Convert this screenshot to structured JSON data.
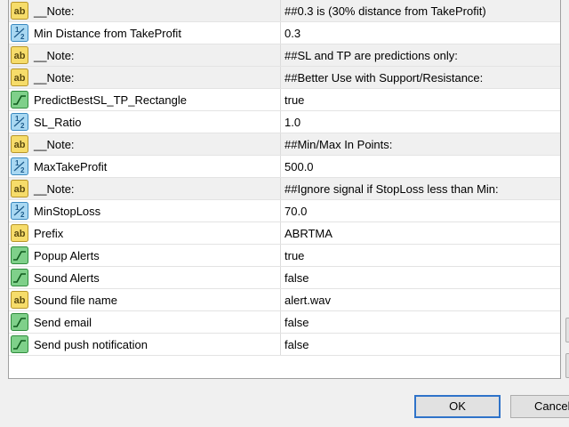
{
  "params": [
    {
      "type": "ab",
      "name": "__Note:",
      "value": "##0.3 is (30% distance from TakeProfit)",
      "icon": "string-icon"
    },
    {
      "type": "half",
      "name": "Min Distance from TakeProfit",
      "value": "0.3",
      "icon": "double-icon"
    },
    {
      "type": "ab",
      "name": "__Note:",
      "value": "##SL and TP are predictions only:",
      "icon": "string-icon"
    },
    {
      "type": "ab",
      "name": "__Note:",
      "value": "##Better Use with Support/Resistance:",
      "icon": "string-icon"
    },
    {
      "type": "bool",
      "name": "PredictBestSL_TP_Rectangle",
      "value": "true",
      "icon": "bool-icon"
    },
    {
      "type": "half",
      "name": "SL_Ratio",
      "value": "1.0",
      "icon": "double-icon"
    },
    {
      "type": "ab",
      "name": "__Note:",
      "value": "##Min/Max In Points:",
      "icon": "string-icon"
    },
    {
      "type": "half",
      "name": "MaxTakeProfit",
      "value": "500.0",
      "icon": "double-icon"
    },
    {
      "type": "ab",
      "name": "__Note:",
      "value": "##Ignore signal if StopLoss less than Min:",
      "icon": "string-icon"
    },
    {
      "type": "half",
      "name": "MinStopLoss",
      "value": "70.0",
      "icon": "double-icon"
    },
    {
      "type": "ab",
      "name": "Prefix",
      "value": "ABRTMA",
      "icon": "string-icon"
    },
    {
      "type": "bool",
      "name": "Popup Alerts",
      "value": "true",
      "icon": "bool-icon"
    },
    {
      "type": "bool",
      "name": "Sound Alerts",
      "value": "false",
      "icon": "bool-icon"
    },
    {
      "type": "ab",
      "name": "Sound file name",
      "value": "alert.wav",
      "icon": "string-icon"
    },
    {
      "type": "bool",
      "name": "Send email",
      "value": "false",
      "icon": "bool-icon"
    },
    {
      "type": "bool",
      "name": "Send push notification",
      "value": "false",
      "icon": "bool-icon"
    }
  ],
  "buttons": {
    "ok": "OK",
    "cancel": "Cancel"
  },
  "colors": {
    "ok_border": "#2f73c9",
    "string_icon": "#e9c84a",
    "double_icon": "#4aa3d8",
    "bool_icon": "#3aa84a"
  }
}
